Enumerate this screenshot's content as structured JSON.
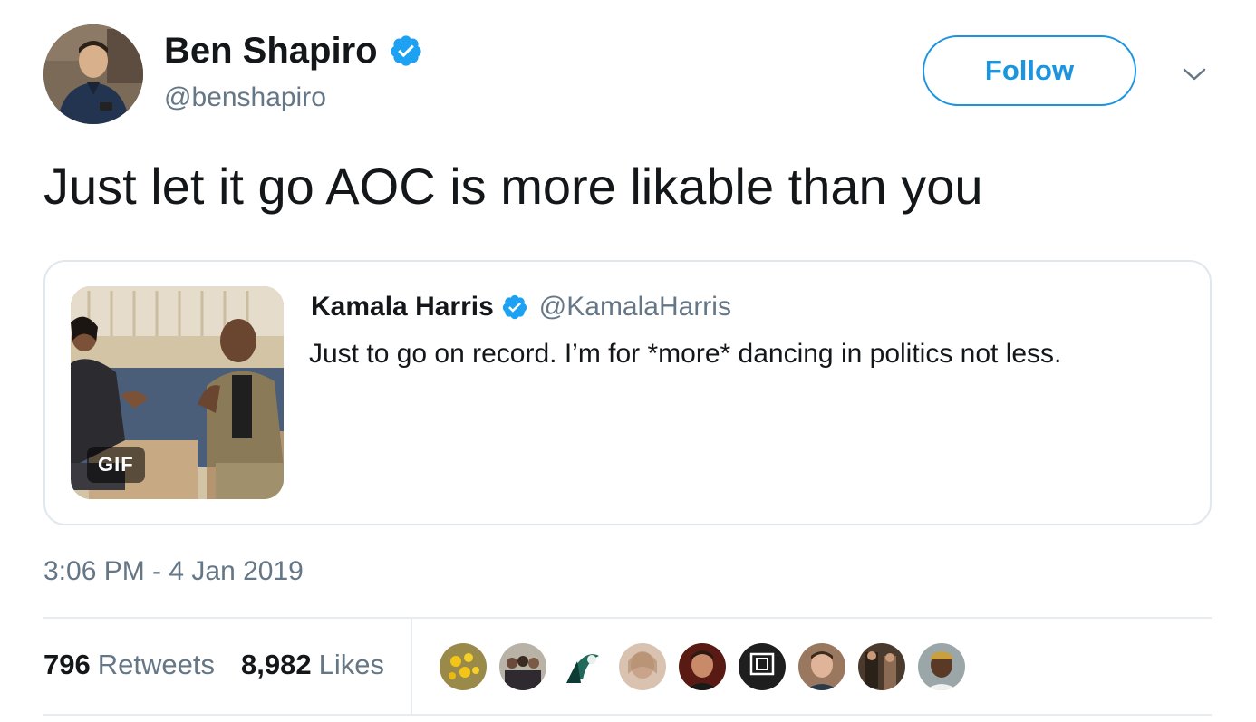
{
  "tweet": {
    "author": {
      "name": "Ben Shapiro",
      "handle": "@benshapiro",
      "verified": true,
      "avatar_icon": "profile-photo"
    },
    "follow_label": "Follow",
    "menu_icon": "chevron-down-icon",
    "text": "Just let it go AOC is more likable than you",
    "quoted": {
      "name": "Kamala Harris",
      "handle": "@KamalaHarris",
      "verified": true,
      "text": "Just to go on record. I’m for *more* dancing in politics not less.",
      "media_badge": "GIF"
    },
    "timestamp": "3:06 PM - 4 Jan 2019",
    "stats": {
      "retweets_count": "796",
      "retweets_label": "Retweets",
      "likes_count": "8,982",
      "likes_label": "Likes"
    },
    "likers_count": 9
  },
  "colors": {
    "accent": "#1b95e0",
    "secondary_text": "#657786",
    "primary_text": "#14171a",
    "border": "#e1e8ed",
    "verified": "#1da1f2"
  }
}
